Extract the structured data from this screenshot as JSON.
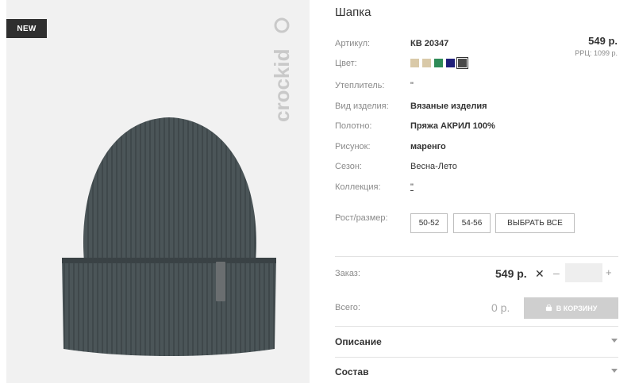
{
  "badge": "NEW",
  "brand_logo": "crockid",
  "product": {
    "title": "Шапка",
    "price": "549 р.",
    "rrp": "РРЦ: 1099 р."
  },
  "attributes": {
    "article_label": "Артикул:",
    "article_value": "КВ 20347",
    "color_label": "Цвет:",
    "insulation_label": "Утеплитель:",
    "insulation_value": "\"",
    "type_label": "Вид изделия:",
    "type_value": "Вязаные изделия",
    "fabric_label": "Полотно:",
    "fabric_value": "Пряжа АКРИЛ 100%",
    "pattern_label": "Рисунок:",
    "pattern_value": "маренго",
    "season_label": "Сезон:",
    "season_value": "Весна-Лето",
    "collection_label": "Коллекция:",
    "collection_value": "\""
  },
  "colors": [
    "#d9c9a8",
    "#d9c9a8",
    "#2e8b57",
    "#1f1f7a",
    "#4a4a4a"
  ],
  "sizes": {
    "label": "Рост/размер:",
    "options": [
      "50-52",
      "54-56"
    ],
    "select_all": "ВЫБРАТЬ ВСЕ"
  },
  "order": {
    "label": "Заказ:",
    "price": "549 р.",
    "times": "✕",
    "minus": "–",
    "plus": "+",
    "qty": ""
  },
  "total": {
    "label": "Всего:",
    "value": "0 р.",
    "cart_button": "В КОРЗИНУ"
  },
  "accordion": {
    "description": "Описание",
    "composition": "Состав"
  }
}
